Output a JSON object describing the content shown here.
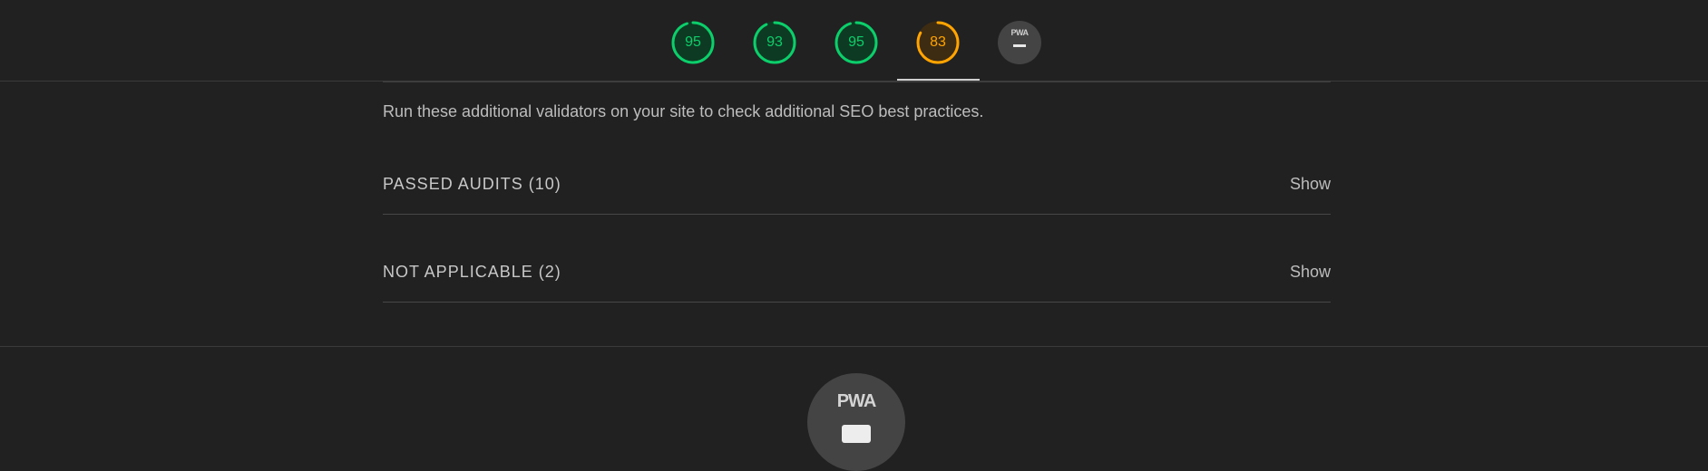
{
  "top_nav": {
    "gauges": [
      {
        "score": "95",
        "fraction": 0.95,
        "color": "#0cce6b",
        "bg": "#0c3a22",
        "active": false
      },
      {
        "score": "93",
        "fraction": 0.93,
        "color": "#0cce6b",
        "bg": "#0c3a22",
        "active": false
      },
      {
        "score": "95",
        "fraction": 0.95,
        "color": "#0cce6b",
        "bg": "#0c3a22",
        "active": false
      },
      {
        "score": "83",
        "fraction": 0.83,
        "color": "#ffa400",
        "bg": "#3d2c12",
        "active": true
      }
    ],
    "pwa_badge": {
      "label": "PWA"
    }
  },
  "main": {
    "description": "Run these additional validators on your site to check additional SEO best practices.",
    "groups": [
      {
        "title": "PASSED AUDITS (10)",
        "toggle": "Show"
      },
      {
        "title": "NOT APPLICABLE (2)",
        "toggle": "Show"
      }
    ]
  },
  "pwa_section": {
    "badge_label": "PWA"
  },
  "colors": {
    "background": "#212121",
    "pass": "#0cce6b",
    "average": "#ffa400"
  }
}
